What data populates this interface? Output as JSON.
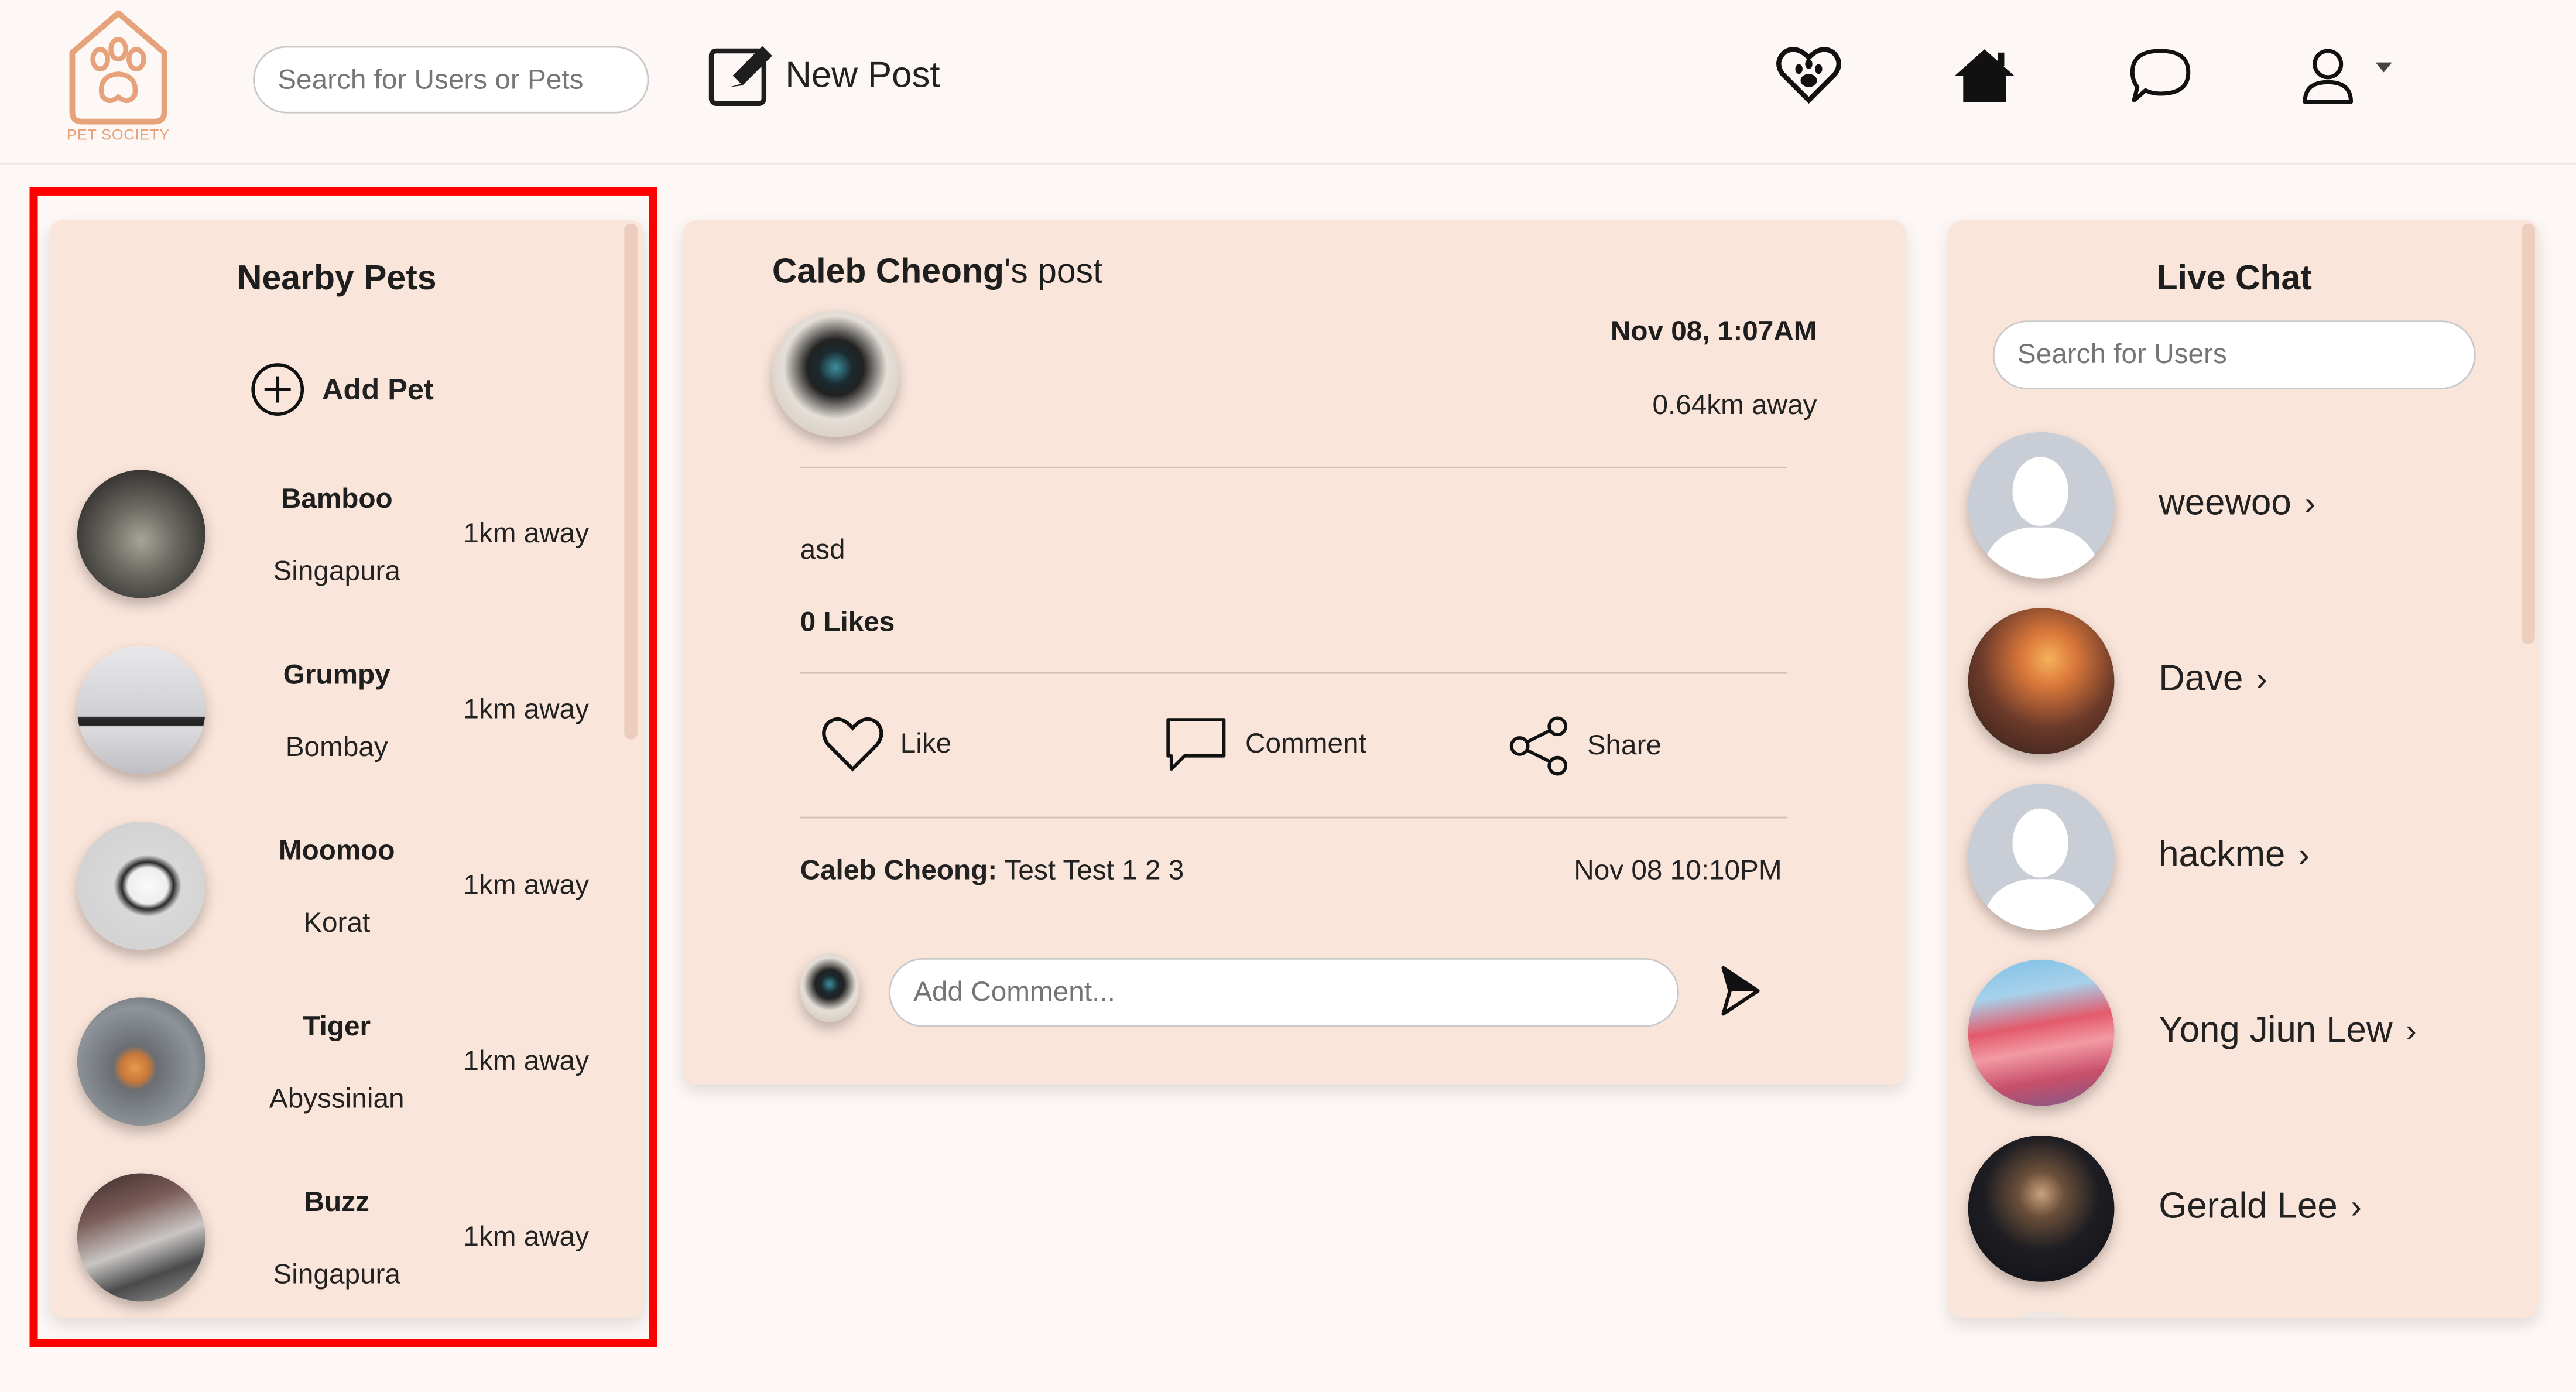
{
  "header": {
    "logo_text": "PET SOCIETY",
    "search_placeholder": "Search for Users or Pets",
    "new_post_label": "New Post",
    "icons": [
      "pet-heart-icon",
      "home-icon",
      "chat-bubble-icon",
      "user-icon",
      "caret-down-icon"
    ]
  },
  "nearby": {
    "title": "Nearby Pets",
    "add_label": "Add Pet",
    "pets": [
      {
        "name": "Bamboo",
        "breed": "Singapura",
        "distance": "1km away"
      },
      {
        "name": "Grumpy",
        "breed": "Bombay",
        "distance": "1km away"
      },
      {
        "name": "Moomoo",
        "breed": "Korat",
        "distance": "1km away"
      },
      {
        "name": "Tiger",
        "breed": "Abyssinian",
        "distance": "1km away"
      },
      {
        "name": "Buzz",
        "breed": "Singapura",
        "distance": "1km away"
      }
    ]
  },
  "post": {
    "author": "Caleb Cheong",
    "title_suffix": "'s post",
    "date": "Nov 08, 1:07AM",
    "distance": "0.64km away",
    "body": "asd",
    "likes": "0 Likes",
    "actions": {
      "like": "Like",
      "comment": "Comment",
      "share": "Share"
    },
    "comments": [
      {
        "author": "Caleb Cheong:",
        "text": " Test Test 1 2 3",
        "time": "Nov 08 10:10PM"
      }
    ],
    "comment_placeholder": "Add Comment..."
  },
  "chat": {
    "title": "Live Chat",
    "search_placeholder": "Search for Users",
    "users": [
      {
        "name": "weewoo"
      },
      {
        "name": "Dave"
      },
      {
        "name": "hackme"
      },
      {
        "name": "Yong Jiun Lew"
      },
      {
        "name": "Gerald Lee"
      }
    ]
  },
  "colors": {
    "page_bg": "#fdf7f5",
    "card_bg": "#fae5da",
    "highlight": "#ff0000",
    "logo_orange": "#e6a27a"
  }
}
